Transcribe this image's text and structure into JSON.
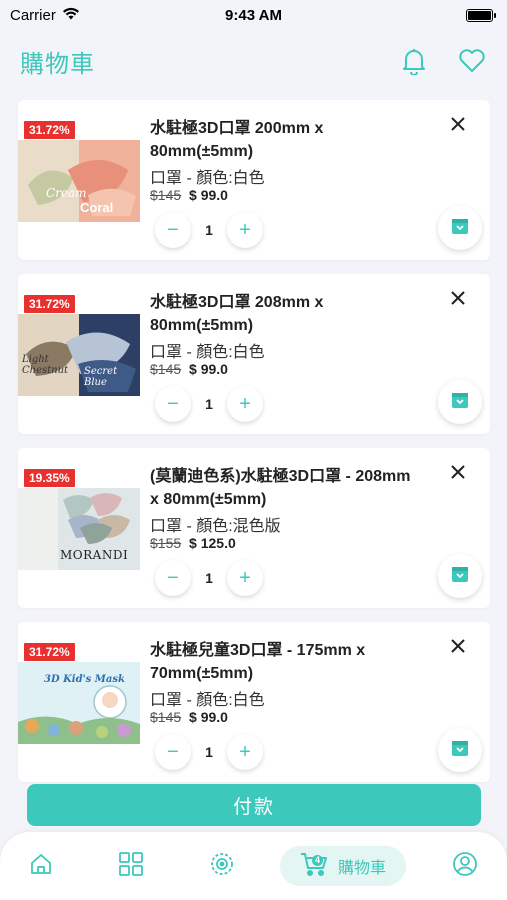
{
  "status": {
    "carrier": "Carrier",
    "time": "9:43 AM"
  },
  "header": {
    "title": "購物車"
  },
  "items": [
    {
      "badge": "31.72%",
      "name": "水駐極3D口罩 200mm x 80mm(±5mm)",
      "variant": "口罩 - 顏色:白色",
      "old_price": "$145",
      "new_price": "$ 99.0",
      "qty": "1",
      "thumb_labels": [
        "Cream",
        "Coral"
      ]
    },
    {
      "badge": "31.72%",
      "name": "水駐極3D口罩 208mm x 80mm(±5mm)",
      "variant": "口罩 - 顏色:白色",
      "old_price": "$145",
      "new_price": "$ 99.0",
      "qty": "1",
      "thumb_labels": [
        "Light Chestnut",
        "Secret Blue"
      ]
    },
    {
      "badge": "19.35%",
      "name": "(莫蘭迪色系)水駐極3D口罩 - 208mm x 80mm(±5mm)",
      "variant": "口罩 - 顏色:混色版",
      "old_price": "$155",
      "new_price": "$ 125.0",
      "qty": "1",
      "thumb_labels": [
        "MORANDI"
      ]
    },
    {
      "badge": "31.72%",
      "name": "水駐極兒童3D口罩 - 175mm x 70mm(±5mm)",
      "variant": "口罩 - 顏色:白色",
      "old_price": "$145",
      "new_price": "$ 99.0",
      "qty": "1",
      "thumb_labels": [
        "3D Kid's Mask"
      ]
    }
  ],
  "checkout": {
    "label": "付款"
  },
  "nav": {
    "cart_label": "購物車",
    "cart_count": "4"
  },
  "colors": {
    "accent": "#3cc8bb",
    "badge": "#e8312f"
  }
}
